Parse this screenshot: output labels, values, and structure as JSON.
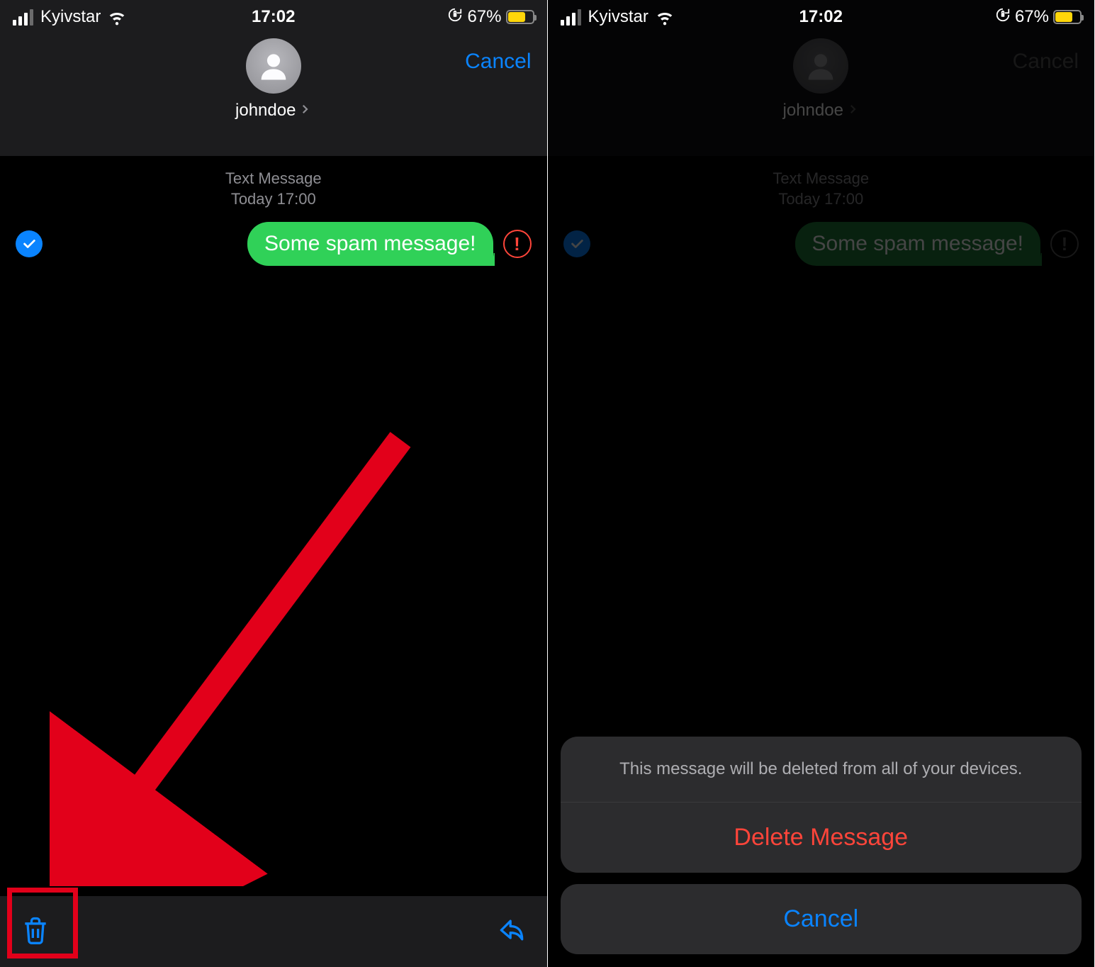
{
  "statusbar": {
    "carrier": "Kyivstar",
    "time": "17:02",
    "battery_pct": "67%",
    "battery_fill_pct": 67
  },
  "header": {
    "contact_name": "johndoe",
    "cancel_label": "Cancel"
  },
  "conversation": {
    "meta_line1": "Text Message",
    "meta_line2": "Today 17:00",
    "message_text": "Some spam message!"
  },
  "action_sheet": {
    "prompt": "This message will be deleted from all of your devices.",
    "delete_label": "Delete Message",
    "cancel_label": "Cancel"
  }
}
